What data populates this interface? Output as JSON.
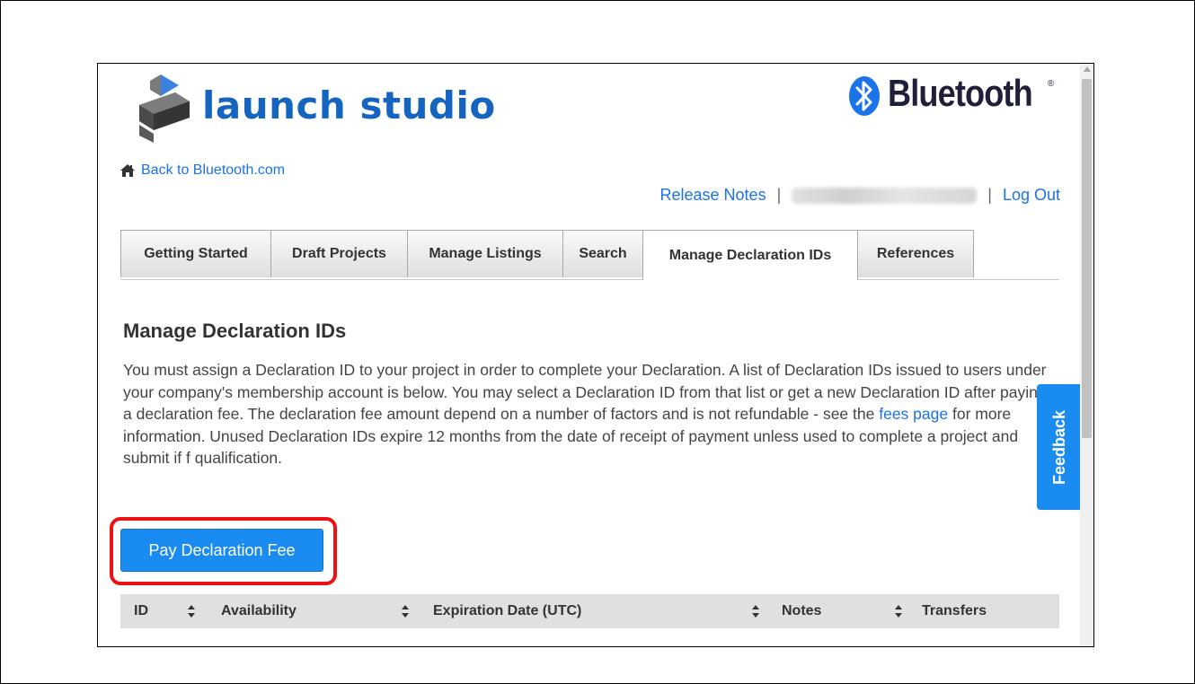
{
  "brand": {
    "name": "launch studio",
    "partner": "Bluetooth",
    "partner_mark": "®"
  },
  "nav": {
    "back_link": "Back to Bluetooth.com",
    "release_notes": "Release Notes",
    "separator": "|",
    "log_out": "Log Out"
  },
  "tabs": [
    {
      "label": "Getting Started",
      "active": false
    },
    {
      "label": "Draft Projects",
      "active": false
    },
    {
      "label": "Manage Listings",
      "active": false
    },
    {
      "label": "Search",
      "active": false
    },
    {
      "label": "Manage Declaration IDs",
      "active": true
    },
    {
      "label": "References",
      "active": false
    }
  ],
  "main": {
    "title": "Manage Declaration IDs",
    "description_before_link": "You must assign a Declaration ID to your project in order to complete your Declaration. A list of Declaration IDs issued to users under your company's membership account is below. You may select a Declaration ID from that list or get a new Declaration ID after paying a declaration fee. The declaration fee amount depend on a number of factors and is not refundable - see the",
    "description_link": "fees page",
    "description_after_link": "for more information. Unused Declaration IDs expire 12 months from the date of receipt of payment unless used to complete a project and submit if f qualification.",
    "pay_button": "Pay Declaration Fee"
  },
  "table": {
    "columns": [
      "ID",
      "Availability",
      "Expiration Date (UTC)",
      "Notes",
      "Transfers"
    ]
  },
  "feedback_label": "Feedback",
  "colors": {
    "link": "#1a73e8",
    "button": "#1a8bf0",
    "logo_text": "#1565c0",
    "highlight": "#ee1111"
  }
}
